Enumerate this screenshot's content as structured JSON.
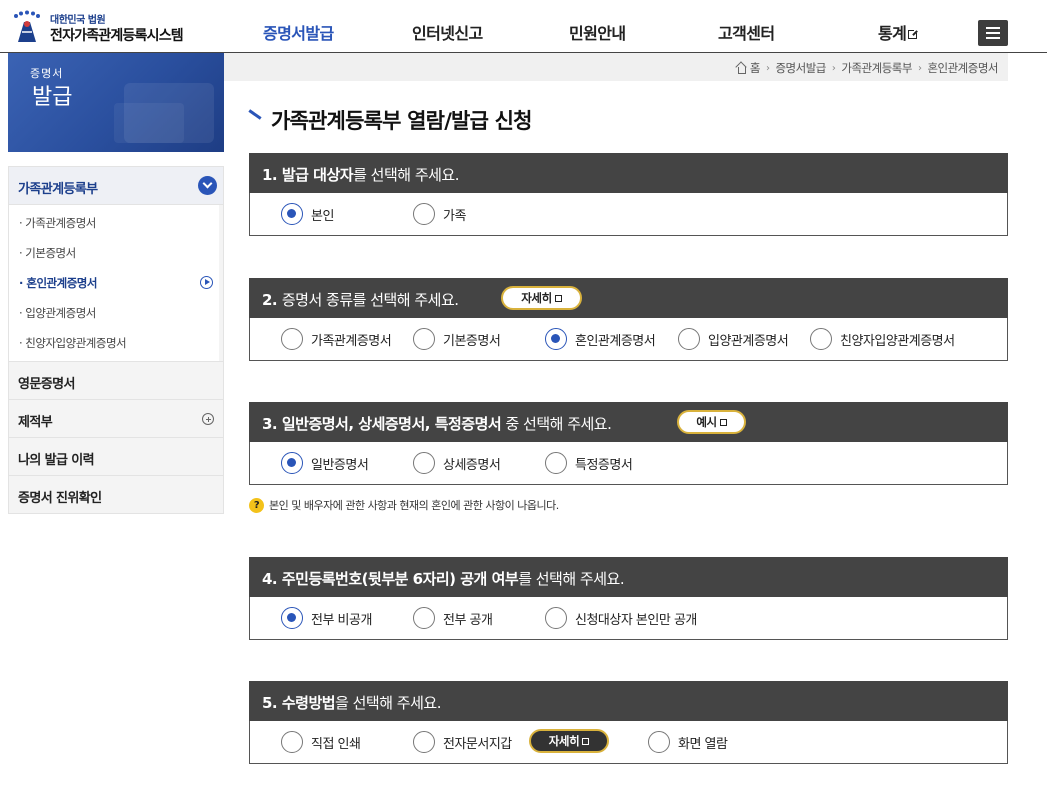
{
  "header": {
    "logo_sub": "대한민국 법원",
    "logo_main": "전자가족관계등록시스템",
    "nav": [
      {
        "label": "증명서발급"
      },
      {
        "label": "인터넷신고"
      },
      {
        "label": "민원안내"
      },
      {
        "label": "고객센터"
      },
      {
        "label": "통계"
      }
    ],
    "accent_color": "#2a55b8"
  },
  "sidebar": {
    "banner_line1": "증명서",
    "banner_line2": "발급",
    "group_title": "가족관계등록부",
    "sub_items": [
      {
        "label": "· 가족관계증명서"
      },
      {
        "label": "· 기본증명서"
      },
      {
        "label": "· 혼인관계증명서"
      },
      {
        "label": "· 입양관계증명서"
      },
      {
        "label": "· 친양자입양관계증명서"
      }
    ],
    "main_items": [
      {
        "label": "영문증명서"
      },
      {
        "label": "제적부"
      },
      {
        "label": "나의 발급 이력"
      },
      {
        "label": "증명서 진위확인"
      }
    ]
  },
  "breadcrumb": [
    "홈",
    "증명서발급",
    "가족관계등록부",
    "혼인관계증명서"
  ],
  "page_title": "가족관계등록부 열람/발급 신청",
  "sections": {
    "s1": {
      "num": "1. ",
      "bold": "발급 대상자",
      "rest": "를 선택해 주세요.",
      "options": [
        "본인",
        "가족"
      ]
    },
    "s2": {
      "num": "2. ",
      "rest": "증명서 종류를 선택해 주세요.",
      "pill": "자세히",
      "options": [
        "가족관계증명서",
        "기본증명서",
        "혼인관계증명서",
        "입양관계증명서",
        "친양자입양관계증명서"
      ]
    },
    "s3": {
      "num": "3. ",
      "bold": "일반증명서, 상세증명서, 특정증명서",
      "rest": " 중 선택해 주세요.",
      "pill": "예시",
      "options": [
        "일반증명서",
        "상세증명서",
        "특정증명서"
      ]
    },
    "s4": {
      "num": "4. ",
      "bold": "주민등록번호(뒷부분 6자리) 공개 여부",
      "rest": "를 선택해 주세요.",
      "options": [
        "전부 비공개",
        "전부 공개",
        "신청대상자 본인만 공개"
      ]
    },
    "s5": {
      "num": "5. ",
      "bold": "수령방법",
      "rest": "을 선택해 주세요.",
      "pill": "자세히",
      "options": [
        "직접 인쇄",
        "전자문서지갑",
        "화면 열람"
      ]
    }
  },
  "note": "본인 및 배우자에 관한 사항과 현재의 혼인에 관한 사항이 나옵니다."
}
